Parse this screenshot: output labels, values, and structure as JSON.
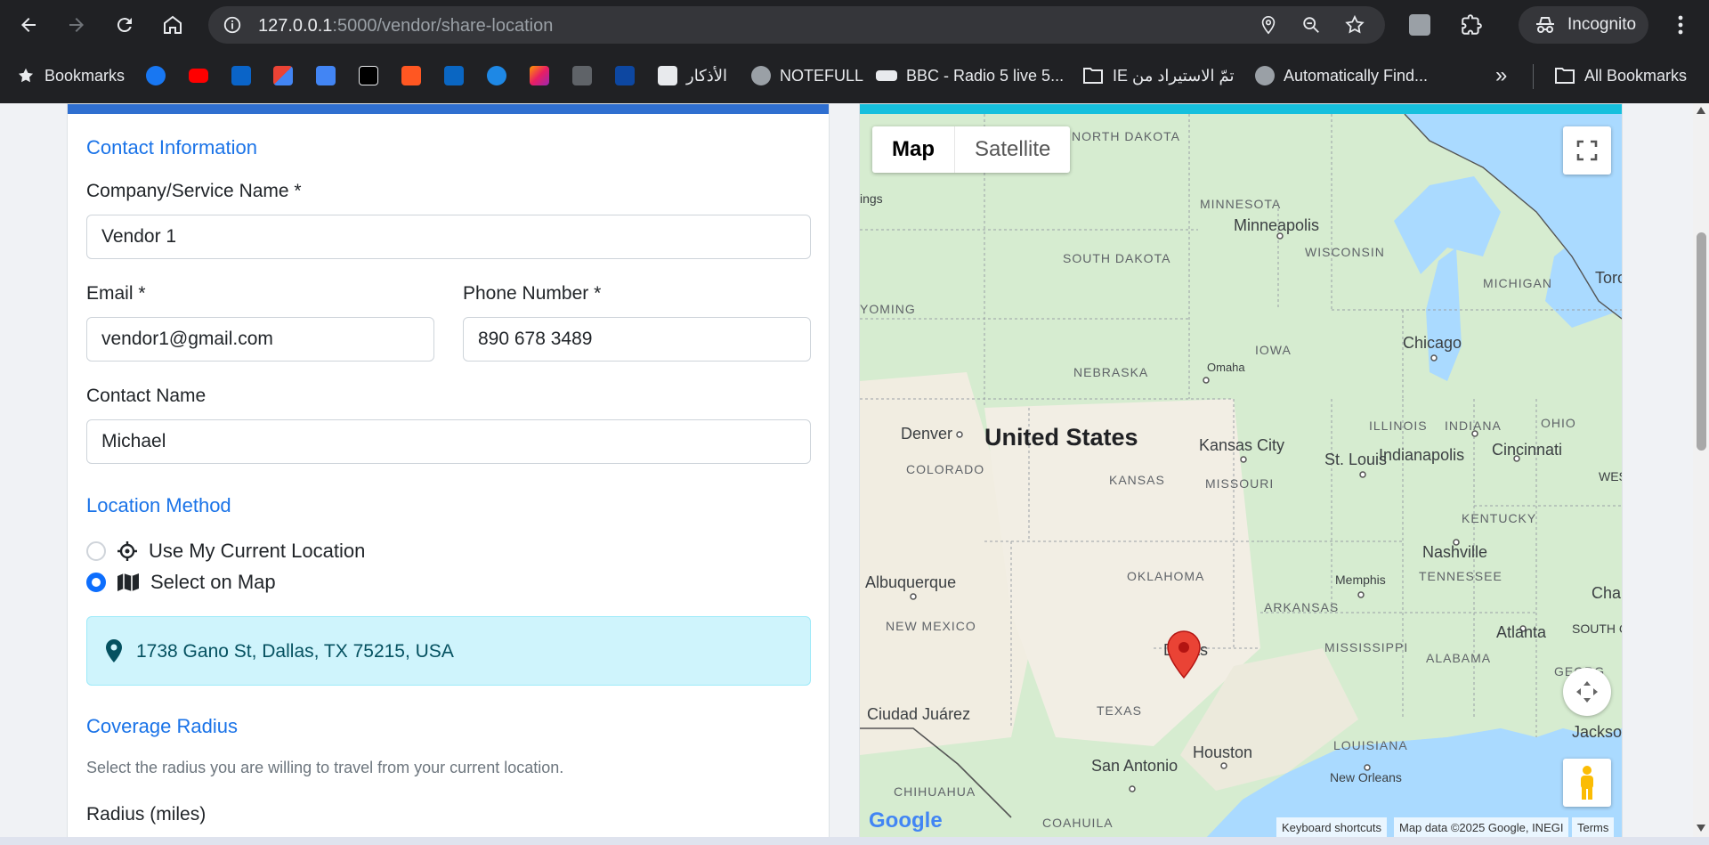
{
  "browser": {
    "url_host": "127.0.0.1",
    "url_rest": ":5000/vendor/share-location",
    "profile_label": "Incognito",
    "bookmarks": {
      "label": "Bookmarks",
      "arabic": "الأذكار",
      "notefull": "NOTEFULL",
      "bbc": "BBC - Radio 5 live 5...",
      "ie_folder": "IE تمّ الاستيراد من",
      "auto": "Automatically Find...",
      "more": "»",
      "all": "All Bookmarks"
    }
  },
  "form": {
    "contact_title": "Contact Information",
    "company_label": "Company/Service Name *",
    "company_value": "Vendor 1",
    "email_label": "Email *",
    "email_value": "vendor1@gmail.com",
    "phone_label": "Phone Number *",
    "phone_value": "890 678 3489",
    "contact_name_label": "Contact Name",
    "contact_name_value": "Michael",
    "location_title": "Location Method",
    "option_current": "Use My Current Location",
    "option_map": "Select on Map",
    "selected_option": "Select on Map",
    "address": "1738 Gano St, Dallas, TX 75215, USA",
    "coverage_title": "Coverage Radius",
    "coverage_help": "Select the radius you are willing to travel from your current location.",
    "radius_label": "Radius (miles)"
  },
  "map": {
    "type_map": "Map",
    "type_satellite": "Satellite",
    "logo": "Google",
    "attribution_shortcuts": "Keyboard shortcuts",
    "attribution_data": "Map data ©2025 Google, INEGI",
    "attribution_terms": "Terms",
    "labels": {
      "north_dakota": "NORTH\nDAKOTA",
      "minnesota": "MINNESOTA",
      "minneapolis": "Minneapolis",
      "wisconsin": "WISCONSIN",
      "south_dakota": "SOUTH\nDAKOTA",
      "michigan": "MICHIGAN",
      "toronto": "Toro",
      "wyoming": "YOMING",
      "iowa": "IOWA",
      "chicago": "Chicago",
      "nebraska": "NEBRASKA",
      "omaha": "Omaha",
      "illinois": "ILLINOIS",
      "indiana": "INDIANA",
      "ohio": "OHIO",
      "denver": "Denver",
      "united_states": "United States",
      "kansas_city": "Kansas City",
      "st_louis": "St. Louis",
      "indianapolis": "Indianapolis",
      "cincinnati": "Cincinnati",
      "colorado": "COLORADO",
      "kansas": "KANSAS",
      "missouri": "MISSOURI",
      "west_virginia": "WES\nVIRGI",
      "kentucky": "KENTUCKY",
      "nashville": "Nashville",
      "oklahoma": "OKLAHOMA",
      "tennessee": "TENNESSEE",
      "albuquerque": "Albuquerque",
      "memphis": "Memphis",
      "arkansas": "ARKANSAS",
      "charlotte": "Char",
      "new_mexico": "NEW MEXICO",
      "atlanta": "Atlanta",
      "south_carolina": "SOUTH\nCARO",
      "mississippi": "MISSISSIPPI",
      "dallas": "Dallas",
      "alabama": "ALABAMA",
      "georgia": "GEORG",
      "ciudad_juarez": "Ciudad Juárez",
      "texas": "TEXAS",
      "louisiana": "LOUISIANA",
      "jacksonville": "Jackson",
      "houston": "Houston",
      "san_antonio": "San Antonio",
      "new_orleans": "New Orleans",
      "chihuahua": "CHIHUAHUA",
      "coahuila": "COAHUILA",
      "ings": "ings"
    }
  }
}
